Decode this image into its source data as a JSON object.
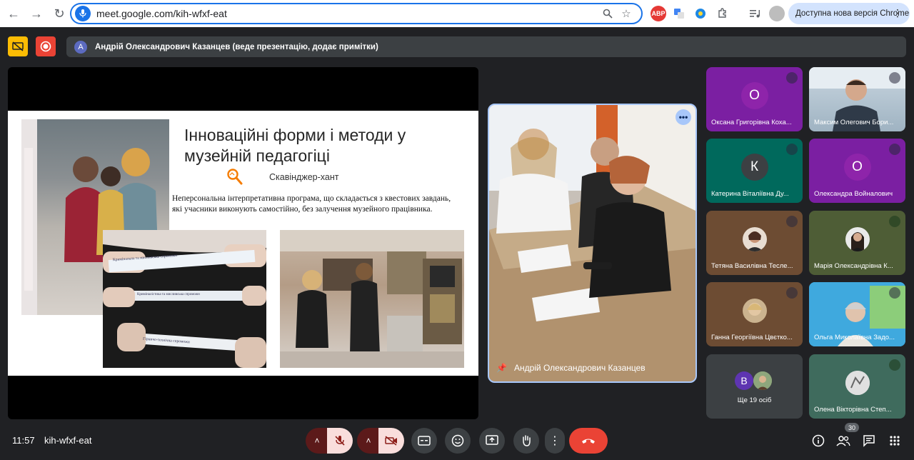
{
  "browser": {
    "url": "meet.google.com/kih-wfxf-eat",
    "extensions": {
      "abp": "ABP"
    },
    "update_label": "Доступна нова версія Chrome"
  },
  "presenter_bar": {
    "avatar_letter": "A",
    "text": "Андрій Олександрович Казанцев (веде презентацію, додає примітки)"
  },
  "slide": {
    "title": "Інноваційні форми і методи у музейній педагогіці",
    "subtitle": "Скавінджер-хант",
    "body": "Неперсональна інтерпретативна програма, що складається з квестових завдань, які учасники виконують самостійно, без залучення музейного працівника.",
    "strips": [
      "Кримінальна та мисливська спроможн",
      "Криміналістика та мисливська спроможн",
      "Гірничо-технічна спроможн"
    ]
  },
  "presenter_tile": {
    "name": "Андрій Олександрович Казанцев"
  },
  "participants": [
    {
      "name": "Оксана Григорівна Коха...",
      "letter": "О",
      "color": "#7b1fa2"
    },
    {
      "name": "Максим Олегович Бори...",
      "letter": "",
      "color": "#8da0b0"
    },
    {
      "name": "Катерина Віталіївна Ду...",
      "letter": "К",
      "color": "#00695c"
    },
    {
      "name": "Олександра Войналович",
      "letter": "О",
      "color": "#8e24aa"
    },
    {
      "name": "Тетяна Василівна Тесле...",
      "letter": "",
      "color": "#6d4c33"
    },
    {
      "name": "Марія Олександрівна К...",
      "letter": "",
      "color": "#4e5d36"
    },
    {
      "name": "Ганна Георгіївна Цвєтко...",
      "letter": "",
      "color": "#6d4c33"
    },
    {
      "name": "Ольга Миколаївна Задо...",
      "letter": "",
      "color": "#2d9cdb"
    },
    {
      "name": "Ще 19 осіб",
      "letter": "В",
      "color": "#3c4043"
    },
    {
      "name": "Олена Вікторівна Степ...",
      "letter": "",
      "color": "#3f6b5d"
    }
  ],
  "bottom": {
    "time": "11:57",
    "code": "kih-wfxf-eat",
    "people_count": "30"
  }
}
